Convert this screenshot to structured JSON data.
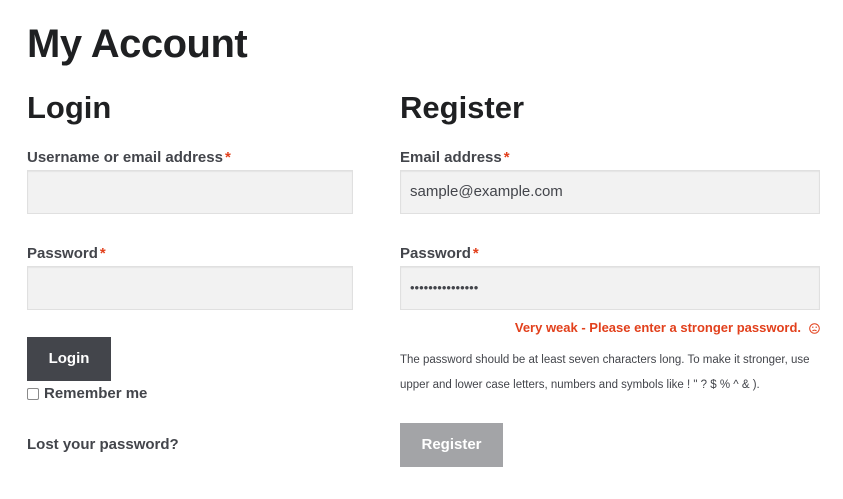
{
  "page": {
    "title": "My Account"
  },
  "login": {
    "heading": "Login",
    "username_label": "Username or email address",
    "username_value": "",
    "password_label": "Password",
    "password_value": "",
    "required_mark": "*",
    "submit_label": "Login",
    "remember_label": "Remember me",
    "remember_checked": false,
    "lost_password_label": "Lost your password?"
  },
  "register": {
    "heading": "Register",
    "email_label": "Email address",
    "email_value": "sample@example.com",
    "password_label": "Password",
    "password_value": "•••••••••••••••",
    "required_mark": "*",
    "strength_text": "Very weak - Please enter a stronger password.",
    "strength_icon": "sad-face-icon",
    "hint_text": "The password should be at least seven characters long. To make it stronger, use upper and lower case letters, numbers and symbols like ! \" ? $ % ^ & ).",
    "submit_label": "Register"
  },
  "colors": {
    "required": "#e2401c",
    "weak_strength": "#e2401c",
    "primary_button": "#43454b",
    "disabled_button": "#a3a4a7",
    "input_bg": "#f2f2f2"
  }
}
